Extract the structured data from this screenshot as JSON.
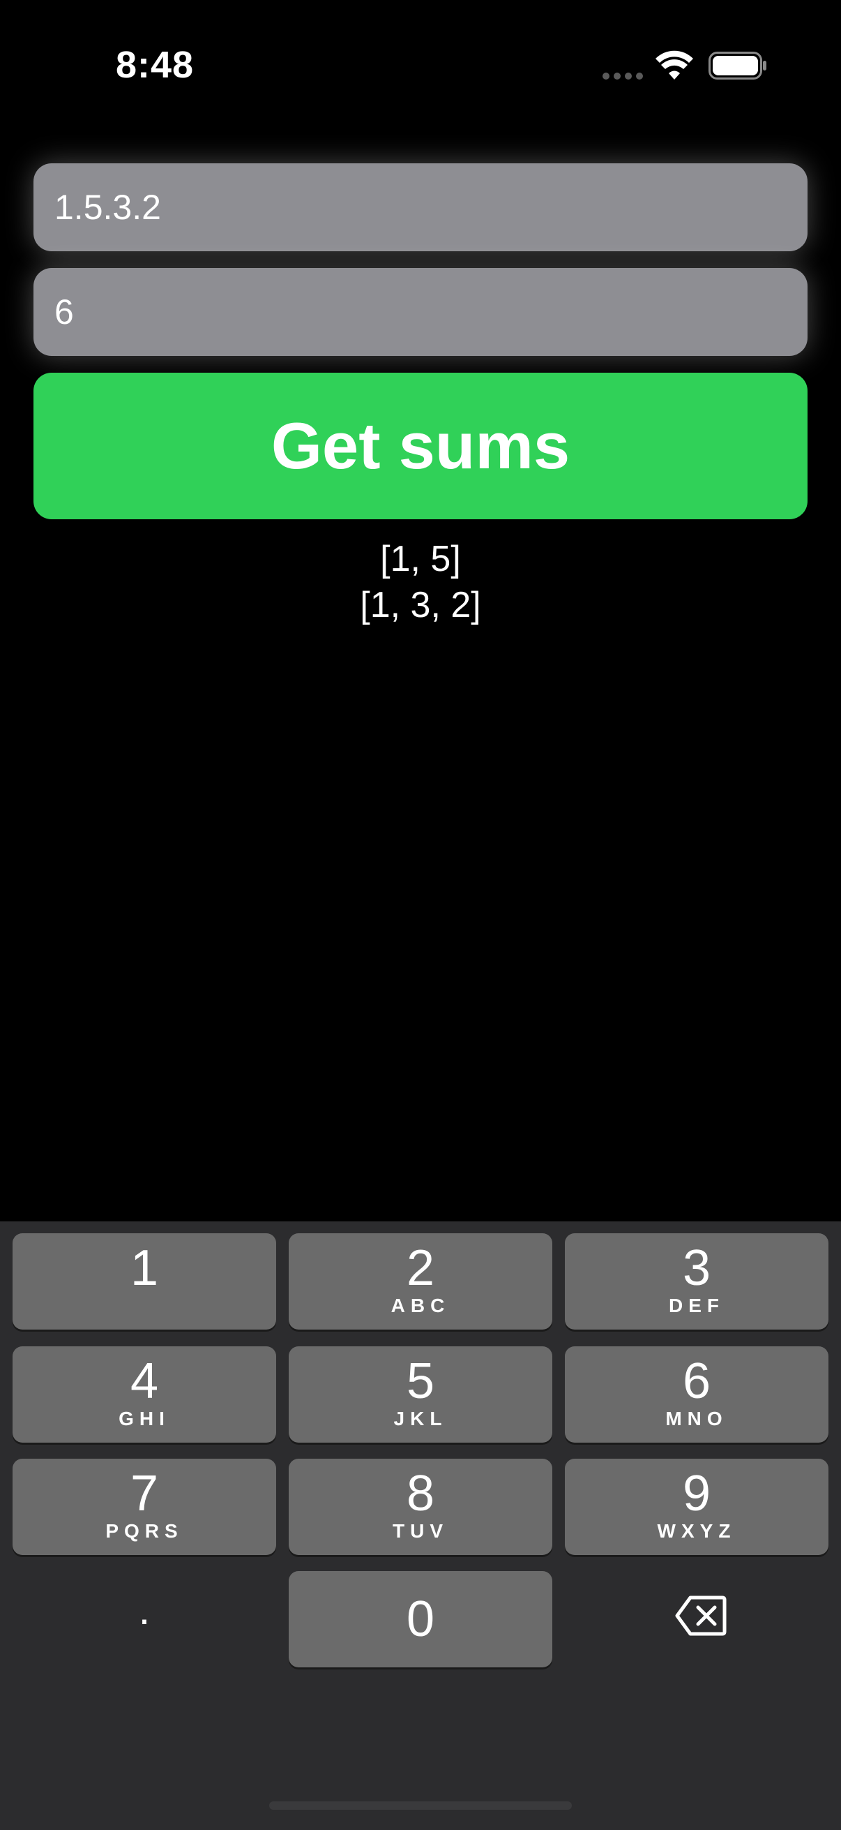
{
  "status_bar": {
    "time": "8:48",
    "icons": [
      "cellular-signal-icon",
      "wifi-icon",
      "battery-icon"
    ]
  },
  "form": {
    "numbers_field": {
      "value": "1.5.3.2"
    },
    "target_field": {
      "value": "6"
    },
    "submit_button": {
      "label": "Get sums"
    }
  },
  "results": {
    "lines": [
      "[1, 5]",
      "[1, 3, 2]"
    ]
  },
  "keyboard": {
    "keys": [
      {
        "digit": "1",
        "letters": ""
      },
      {
        "digit": "2",
        "letters": "ABC"
      },
      {
        "digit": "3",
        "letters": "DEF"
      },
      {
        "digit": "4",
        "letters": "GHI"
      },
      {
        "digit": "5",
        "letters": "JKL"
      },
      {
        "digit": "6",
        "letters": "MNO"
      },
      {
        "digit": "7",
        "letters": "PQRS"
      },
      {
        "digit": "8",
        "letters": "TUV"
      },
      {
        "digit": "9",
        "letters": "WXYZ"
      }
    ],
    "dot_key": ".",
    "zero_key": "0",
    "delete_icon": "delete-backspace-icon"
  },
  "colors": {
    "background": "#000000",
    "field_background": "#8e8e93",
    "button_background": "#30d158",
    "keyboard_background": "#2c2c2e",
    "key_background": "#6b6b6b"
  }
}
